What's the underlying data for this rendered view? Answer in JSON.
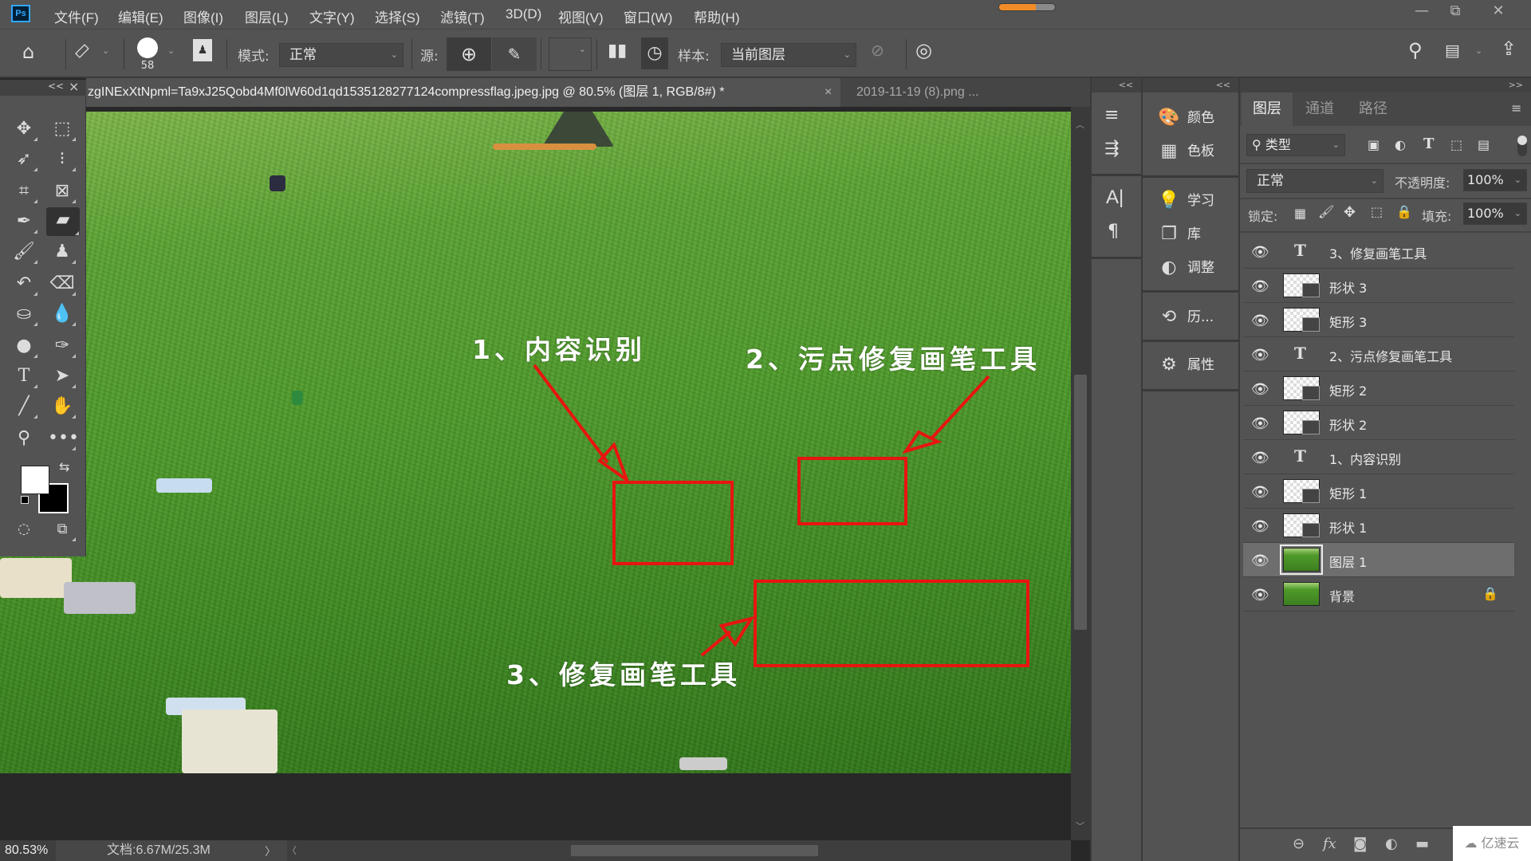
{
  "app": {
    "logo": "Ps"
  },
  "menu": [
    "文件(F)",
    "编辑(E)",
    "图像(I)",
    "图层(L)",
    "文字(Y)",
    "选择(S)",
    "滤镜(T)",
    "3D(D)",
    "视图(V)",
    "窗口(W)",
    "帮助(H)"
  ],
  "progress": {
    "fraction": 0.65,
    "color": "#f28c28"
  },
  "window_controls": {
    "minimize": "—",
    "restore": "⧉",
    "close": "✕"
  },
  "options": {
    "brush_size": "58",
    "mode_label": "模式:",
    "mode_value": "正常",
    "source_label": "源:",
    "sample_label": "样本:",
    "sample_value": "当前图层"
  },
  "tabs": [
    {
      "label": "zgINExXtNpml=Ta9xJ25Qobd4Mf0lW60d1qd1535128277124compressflag.jpeg.jpg  @  80.5%  (图层 1, RGB/8#) *",
      "close": "×",
      "active": true
    },
    {
      "label": "2019-11-19 (8).png ...",
      "close": "×",
      "active": false
    }
  ],
  "toolbox": {
    "collapse": "<<",
    "close": "×"
  },
  "canvas": {
    "annotations": [
      "1、内容识别",
      "2、污点修复画笔工具",
      "3、修复画笔工具"
    ],
    "annotation_color": "#e8150f"
  },
  "status": {
    "zoom": "80.53%",
    "doc_info": "文档:6.67M/25.3M",
    "arrow_right": "〉",
    "arrow_left": "〈"
  },
  "dock_mid": {
    "collapse": "<<",
    "items": [
      {
        "label": "颜色",
        "icon": "palette-icon"
      },
      {
        "label": "色板",
        "icon": "swatches-icon"
      },
      {
        "label": "学习",
        "icon": "lightbulb-icon"
      },
      {
        "label": "库",
        "icon": "library-icon"
      },
      {
        "label": "调整",
        "icon": "adjustments-icon"
      },
      {
        "label": "历...",
        "icon": "history-icon"
      },
      {
        "label": "属性",
        "icon": "properties-icon"
      }
    ]
  },
  "layers_panel": {
    "expand": ">>",
    "tabs": [
      "图层",
      "通道",
      "路径"
    ],
    "filter_label": "类型",
    "blend_mode": "正常",
    "opacity_label": "不透明度:",
    "opacity_value": "100%",
    "lock_label": "锁定:",
    "fill_label": "填充:",
    "fill_value": "100%",
    "layers": [
      {
        "name": "3、修复画笔工具",
        "type": "text",
        "visible": true
      },
      {
        "name": "形状 3",
        "type": "shape",
        "visible": true
      },
      {
        "name": "矩形 3",
        "type": "shape",
        "visible": true
      },
      {
        "name": "2、污点修复画笔工具",
        "type": "text",
        "visible": true
      },
      {
        "name": "矩形 2",
        "type": "shape",
        "visible": true
      },
      {
        "name": "形状 2",
        "type": "shape",
        "visible": true
      },
      {
        "name": "1、内容识别",
        "type": "text",
        "visible": true
      },
      {
        "name": "矩形 1",
        "type": "shape",
        "visible": true
      },
      {
        "name": "形状 1",
        "type": "shape",
        "visible": true
      },
      {
        "name": "图层 1",
        "type": "image",
        "visible": true,
        "selected": true
      },
      {
        "name": "背景",
        "type": "image",
        "visible": true,
        "locked": true
      }
    ]
  },
  "watermark": "亿速云"
}
